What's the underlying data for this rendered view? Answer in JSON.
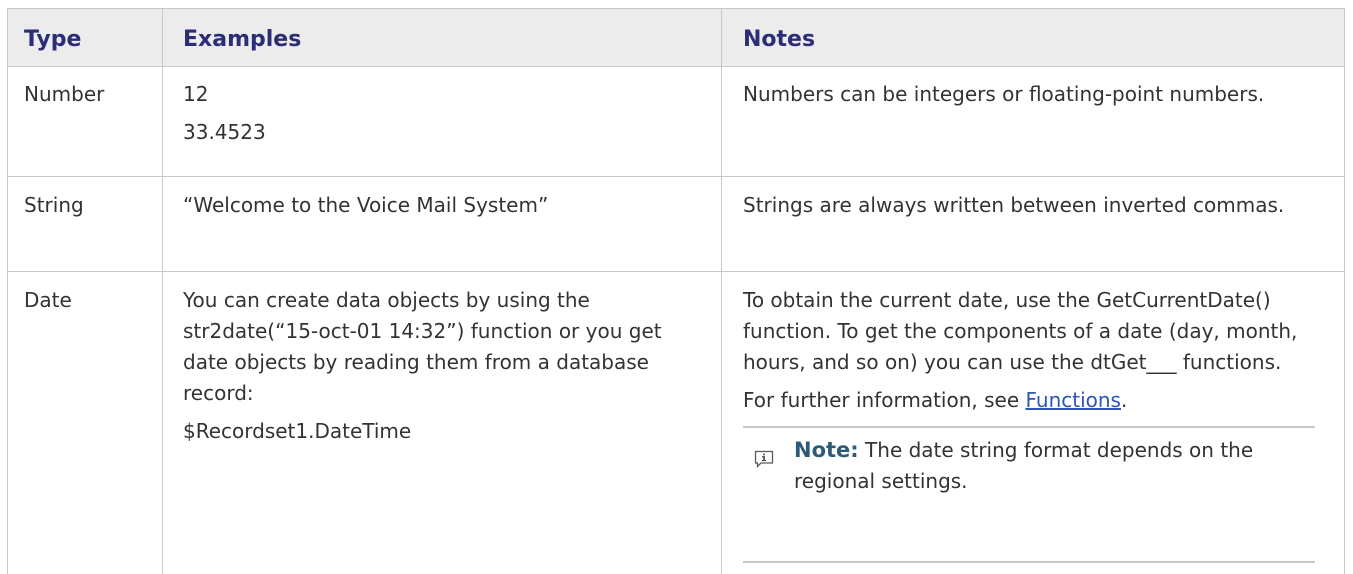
{
  "table": {
    "headers": {
      "type": "Type",
      "examples": "Examples",
      "notes": "Notes"
    },
    "rows": [
      {
        "type": "Number",
        "examples": [
          "12",
          "33.4523"
        ],
        "notes": "Numbers can be integers or floating-point numbers."
      },
      {
        "type": "String",
        "examples": [
          "“Welcome to the Voice Mail System”"
        ],
        "notes": "Strings are always written between inverted commas."
      },
      {
        "type": "Date",
        "examples": [
          "You can create data objects by using the str2date(“15-oct-01 14:32”) function or you get date objects by reading them from a database record:",
          "$Recordset1.DateTime"
        ],
        "notes": "To obtain the current date, use the GetCurrentDate() function. To get the components of a date (day, month, hours, and so on) you can use the dtGet___ functions.",
        "further_prefix": "For further information, see ",
        "further_link": "Functions",
        "further_suffix": ".",
        "note_label": "Note:",
        "note_text": " The date string format depends on the regional settings."
      }
    ]
  },
  "icons": {
    "note": "info-note-icon"
  },
  "colors": {
    "header_bg": "#ececec",
    "header_text": "#2b2d77",
    "link": "#2e54b8",
    "border": "#c8c8c8"
  }
}
